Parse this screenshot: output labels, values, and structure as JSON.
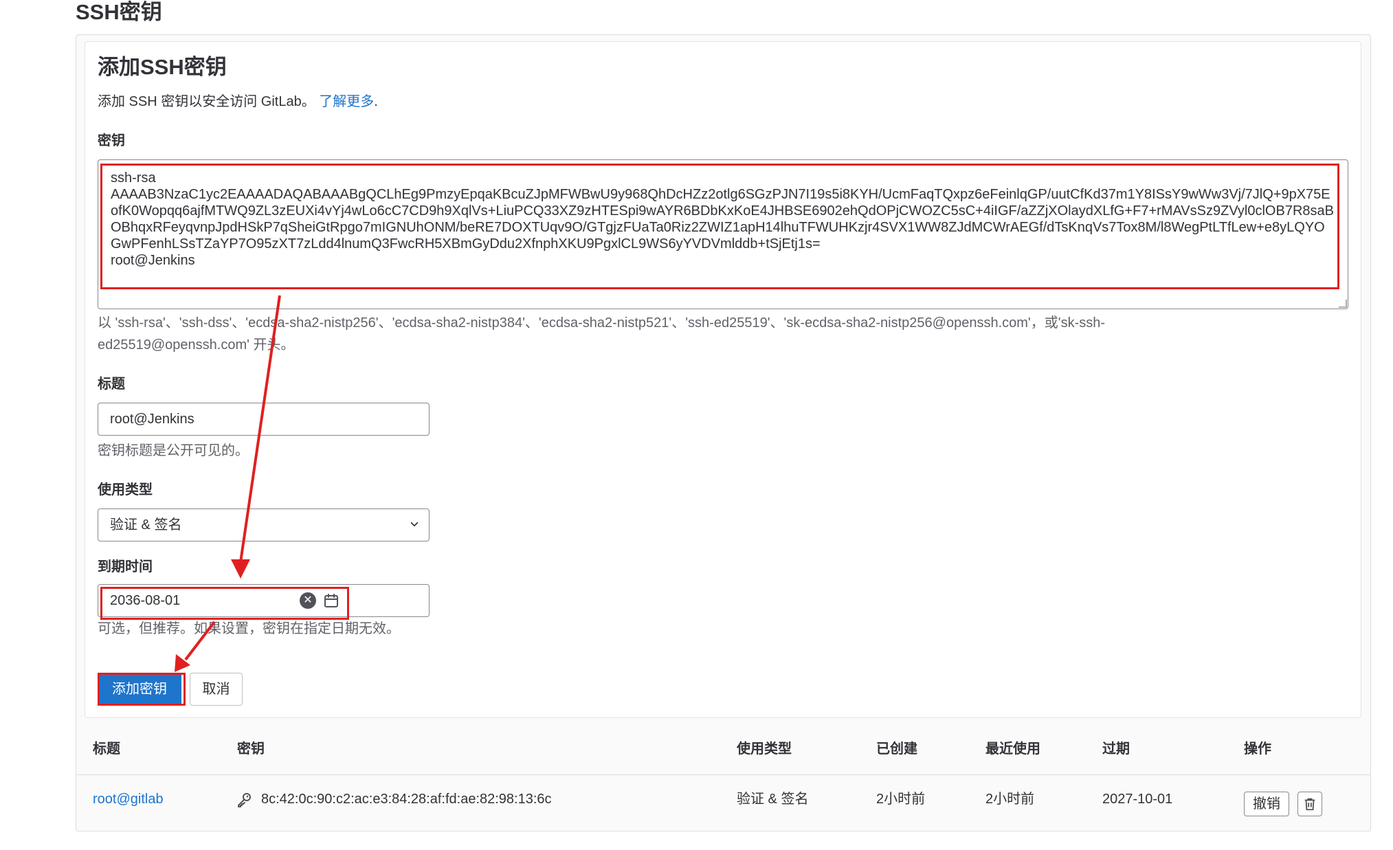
{
  "page": {
    "title": "SSH密钥"
  },
  "form": {
    "heading": "添加SSH密钥",
    "intro": "添加 SSH 密钥以安全访问 GitLab。",
    "learn_more": "了解更多",
    "intro_tail": ".",
    "key_label": "密钥",
    "key_value": "ssh-rsa\nAAAAB3NzaC1yc2EAAAADAQABAAABgQCLhEg9PmzyEpqaKBcuZJpMFWBwU9y968QhDcHZz2otlg6SGzPJN7I19s5i8KYH/UcmFaqTQxpz6eFeinlqGP/uutCfKd37m1Y8ISsY9wWw3Vj/7JlQ+9pX75EofK0Wopqq6ajfMTWQ9ZL3zEUXi4vYj4wLo6cC7CD9h9XqlVs+LiuPCQ33XZ9zHTESpi9wAYR6BDbKxKoE4JHBSE6902ehQdOPjCWOZC5sC+4iIGF/aZZjXOlaydXLfG+F7+rMAVsSz9ZVyl0clOB7R8saBOBhqxRFeyqvnpJpdHSkP7qSheiGtRpgo7mIGNUhONM/beRE7DOXTUqv9O/GTgjzFUaTa0Riz2ZWIZ1apH14lhuTFWUHKzjr4SVX1WW8ZJdMCWrAEGf/dTsKnqVs7Tox8M/l8WegPtLTfLew+e8yLQYOGwPFenhLSsTZaYP7O95zXT7zLdd4lnumQ3FwcRH5XBmGyDdu2XfnphXKU9PgxlCL9WS6yYVDVmlddb+tSjEtj1s=\nroot@Jenkins",
    "key_help_1": "以 'ssh-rsa'、'ssh-dss'、'ecdsa-sha2-nistp256'、'ecdsa-sha2-nistp384'、'ecdsa-sha2-nistp521'、'ssh-ed25519'、'sk-ecdsa-sha2-nistp256@openssh.com'，或'sk-ssh-",
    "key_help_2": "ed25519@openssh.com' 开头。",
    "title_label": "标题",
    "title_value": "root@Jenkins",
    "title_help": "密钥标题是公开可见的。",
    "usage_label": "使用类型",
    "usage_value": "验证 & 签名",
    "expiry_label": "到期时间",
    "expiry_value": "2036-08-01",
    "expiry_help": "可选，但推荐。如果设置，密钥在指定日期无效。",
    "submit_label": "添加密钥",
    "cancel_label": "取消"
  },
  "table": {
    "headers": {
      "title": "标题",
      "key": "密钥",
      "usage": "使用类型",
      "created": "已创建",
      "last_used": "最近使用",
      "expires": "过期",
      "actions": "操作"
    },
    "rows": [
      {
        "title": "root@gitlab",
        "fingerprint": "8c:42:0c:90:c2:ac:e3:84:28:af:fd:ae:82:98:13:6c",
        "usage": "验证 & 签名",
        "created": "2小时前",
        "last_used": "2小时前",
        "expires": "2027-10-01",
        "revoke_label": "撤销"
      }
    ]
  },
  "icons": {
    "dropdown": "chevron-down-icon",
    "clear": "clear-icon",
    "calendar": "calendar-icon",
    "key": "key-icon",
    "delete": "trash-icon"
  },
  "colors": {
    "primary": "#1f75cb",
    "link": "#1f75cb",
    "annotation": "#e02020"
  }
}
